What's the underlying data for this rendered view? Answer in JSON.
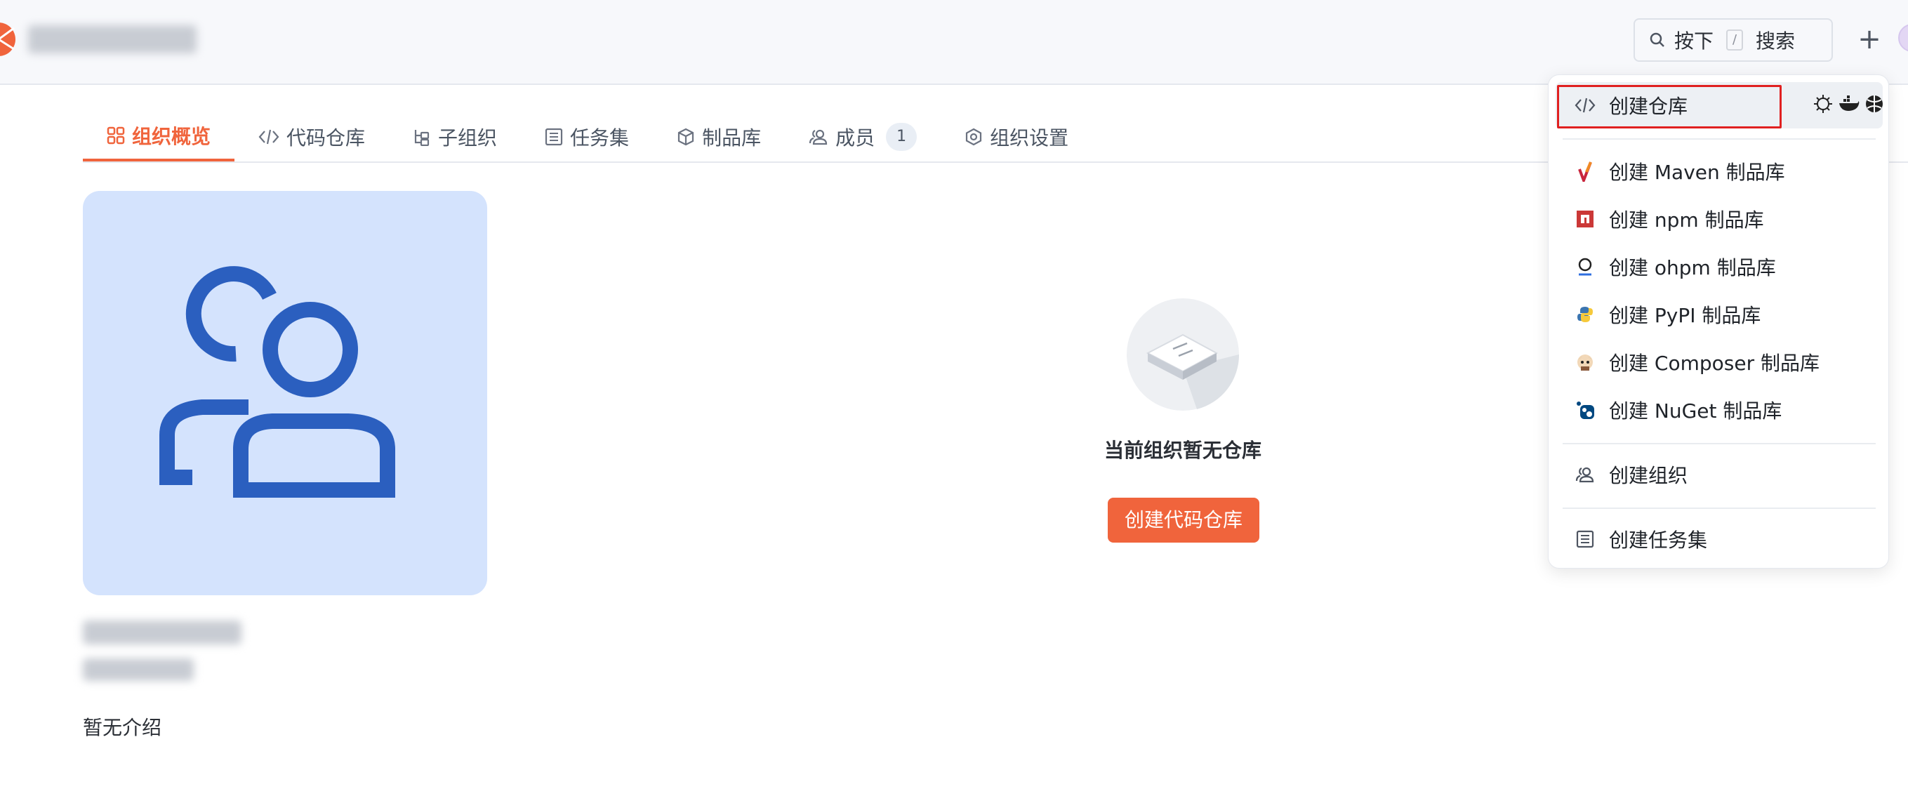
{
  "header": {
    "search_prefix": "按下",
    "search_key": "/",
    "search_suffix": "搜索",
    "plus_label": "+"
  },
  "tabs": [
    {
      "label": "组织概览",
      "icon": "grid-icon"
    },
    {
      "label": "代码仓库",
      "icon": "code-icon"
    },
    {
      "label": "子组织",
      "icon": "tree-icon"
    },
    {
      "label": "任务集",
      "icon": "list-icon"
    },
    {
      "label": "制品库",
      "icon": "package-icon"
    },
    {
      "label": "成员",
      "icon": "users-icon",
      "badge": "1"
    },
    {
      "label": "组织设置",
      "icon": "settings-icon"
    }
  ],
  "org": {
    "description": "暂无介绍"
  },
  "empty_state": {
    "text": "当前组织暂无仓库",
    "button": "创建代码仓库"
  },
  "dropdown": {
    "items": [
      {
        "label": "创建仓库",
        "icon": "code-icon"
      },
      {
        "label": "创建 Maven 制品库",
        "icon": "maven-icon"
      },
      {
        "label": "创建 npm 制品库",
        "icon": "npm-icon"
      },
      {
        "label": "创建 ohpm 制品库",
        "icon": "ohpm-icon"
      },
      {
        "label": "创建 PyPI 制品库",
        "icon": "pypi-icon"
      },
      {
        "label": "创建 Composer 制品库",
        "icon": "composer-icon"
      },
      {
        "label": "创建 NuGet 制品库",
        "icon": "nuget-icon"
      },
      {
        "label": "创建组织",
        "icon": "users-icon"
      },
      {
        "label": "创建任务集",
        "icon": "list-icon"
      }
    ]
  },
  "colors": {
    "accent": "#f0643c",
    "highlight_border": "#e02020",
    "avatar_bg": "#d4e3fd",
    "avatar_fg": "#2b5fbf"
  }
}
